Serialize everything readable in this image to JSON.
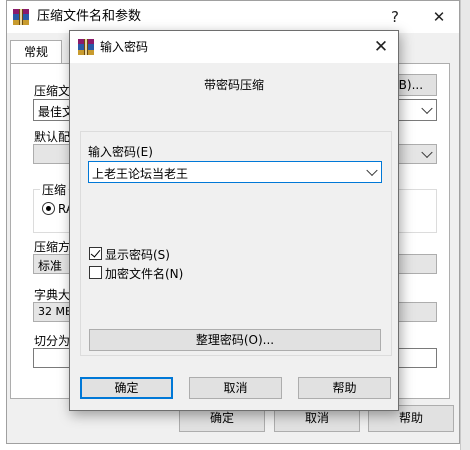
{
  "parent": {
    "title": "压缩文件名和参数",
    "help_glyph": "?",
    "close_glyph": "✕",
    "tab_general": "常规",
    "archive_name_label": "压缩文",
    "browse_label": "(B)...",
    "archive_name_value": "最佳文",
    "default_config_label": "默认配",
    "format_group_label": "压缩",
    "format_option": "RA",
    "method_label": "压缩方",
    "method_value": "标准",
    "dict_label": "字典大",
    "dict_value": "32 MB",
    "split_label": "切分为",
    "ok_label": "确定",
    "cancel_label": "取消",
    "help_label": "帮助"
  },
  "dialog": {
    "title": "输入密码",
    "close_glyph": "✕",
    "heading": "带密码压缩",
    "password_label": "输入密码(E)",
    "password_value": "上老王论坛当老王",
    "show_password_label": "显示密码(S)",
    "show_password_checked": true,
    "encrypt_filenames_label": "加密文件名(N)",
    "encrypt_filenames_checked": false,
    "organize_button": "整理密码(O)...",
    "ok_button": "确定",
    "cancel_button": "取消",
    "help_button": "帮助"
  }
}
